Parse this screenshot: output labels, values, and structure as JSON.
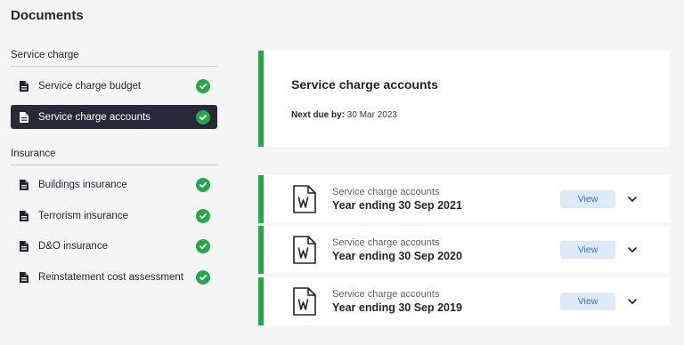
{
  "page": {
    "title": "Documents"
  },
  "sidebar": {
    "sections": [
      {
        "heading": "Service charge",
        "items": [
          {
            "label": "Service charge budget",
            "status": "complete",
            "active": false
          },
          {
            "label": "Service charge accounts",
            "status": "complete",
            "active": true
          }
        ]
      },
      {
        "heading": "Insurance",
        "items": [
          {
            "label": "Buildings insurance",
            "status": "complete",
            "active": false
          },
          {
            "label": "Terrorism insurance",
            "status": "complete",
            "active": false
          },
          {
            "label": "D&O insurance",
            "status": "complete",
            "active": false
          },
          {
            "label": "Reinstatement cost assessment",
            "status": "complete",
            "active": false
          }
        ]
      }
    ]
  },
  "summary": {
    "title": "Service charge accounts",
    "due_label": "Next due by:",
    "due_value": "30 Mar 2023"
  },
  "documents": [
    {
      "type": "Service charge accounts",
      "period": "Year ending 30 Sep 2021",
      "view_label": "View",
      "file_icon": "word-doc-icon"
    },
    {
      "type": "Service charge accounts",
      "period": "Year ending 30 Sep 2020",
      "view_label": "View",
      "file_icon": "word-doc-icon"
    },
    {
      "type": "Service charge accounts",
      "period": "Year ending 30 Sep 2019",
      "view_label": "View",
      "file_icon": "word-doc-icon"
    }
  ],
  "colors": {
    "accent_green": "#22a94a",
    "active_nav_bg": "#262a36",
    "view_button_bg": "#dce9f8",
    "view_button_text": "#3b6fb6"
  }
}
